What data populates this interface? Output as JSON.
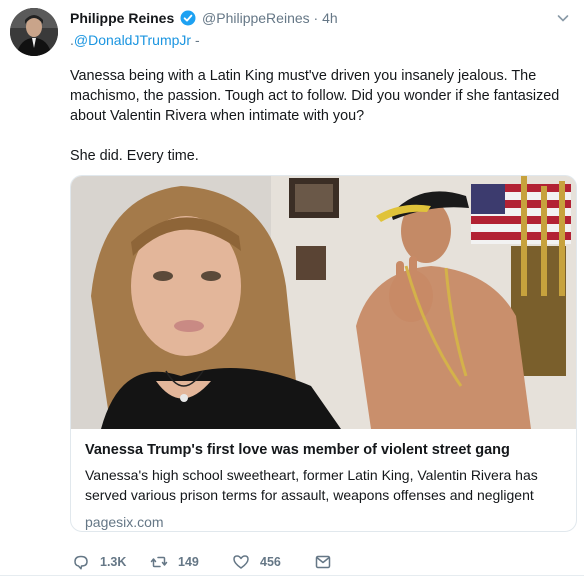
{
  "user": {
    "name": "Philippe Reines",
    "handle": "@PhilippeReines",
    "dot": "·",
    "time": "4h",
    "verified": true
  },
  "replying": {
    "prefix": ".",
    "mention": "@DonaldJTrumpJr",
    "suffix": " -"
  },
  "tweet": {
    "paragraph_1": "Vanessa being with a Latin King must've driven you insanely jealous. The machismo, the passion. Tough act to follow. Did you wonder if she fantasized about Valentin Rivera when intimate with you?",
    "paragraph_2": "She did. Every time."
  },
  "card": {
    "title": "Vanessa Trump's first love was member of violent street gang",
    "description": "Vanessa's high school sweetheart, former Latin King, Valentin Rivera has served various prison terms for assault, weapons offenses and negligent",
    "domain": "pagesix.com"
  },
  "actions": {
    "replies": "1.3K",
    "retweets": "149",
    "likes": "456"
  },
  "icons": {
    "verified": "verified-badge-icon",
    "caret": "chevron-down-icon",
    "reply": "reply-icon",
    "retweet": "retweet-icon",
    "like": "heart-icon",
    "dm": "envelope-icon"
  },
  "colors": {
    "link": "#1b95e0",
    "secondary_text": "#657786",
    "verified": "#1da1f2",
    "border": "#e1e8ed"
  }
}
